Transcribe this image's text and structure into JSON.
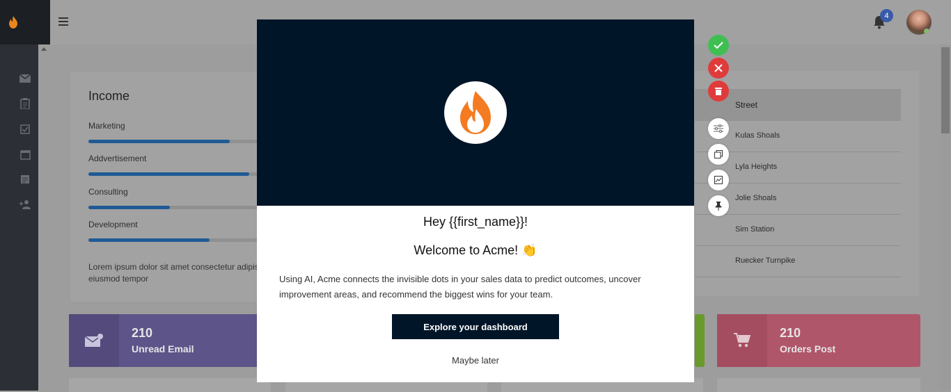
{
  "header": {
    "notification_count": "4"
  },
  "income": {
    "title": "Income",
    "items": [
      {
        "label": "Marketing",
        "progress": 0.78
      },
      {
        "label": "Addvertisement",
        "progress": 0.89
      },
      {
        "label": "Consulting",
        "progress": 0.45
      },
      {
        "label": "Development",
        "progress": 0.67
      }
    ],
    "description": "Lorem ipsum dolor sit amet consectetur adipis eiusmod tempor"
  },
  "table": {
    "header": "Street",
    "rows": [
      "Kulas Shoals",
      "Lyla Heights",
      "Jolie Shoals",
      "Sim Station",
      "Ruecker Turnpike"
    ]
  },
  "stats": [
    {
      "value": "210",
      "label": "Unread Email",
      "color": "#6a5f9c"
    },
    {
      "value": "210",
      "label": "Orders Post",
      "color": "#c45c70"
    }
  ],
  "modal": {
    "greeting": "Hey {{first_name}}!",
    "welcome": "Welcome to Acme! 👏",
    "body": "Using AI, Acme connects the invisible dots  in your sales data to predict outcomes, uncover improvement areas, and recommend the biggest wins for your team.",
    "cta_label": "Explore your dashboard",
    "dismiss_label": "Maybe later"
  },
  "colors": {
    "modal_dark": "#001528",
    "flame_orange": "#f47b20",
    "approve_green": "#3fbf52",
    "reject_red": "#e03b3b"
  }
}
